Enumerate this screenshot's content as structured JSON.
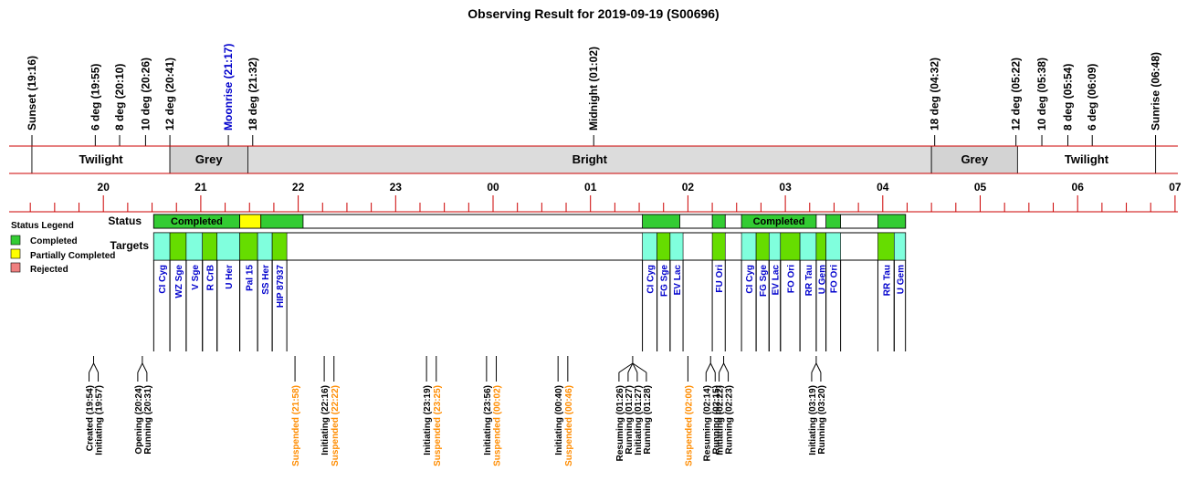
{
  "chart_data": {
    "type": "timeline",
    "title": "Observing Result for 2019-09-19 (S00696)",
    "time_range": [
      -4.8,
      7.0
    ],
    "hour_ticks": [
      "20",
      "21",
      "22",
      "23",
      "00",
      "01",
      "02",
      "03",
      "04",
      "05",
      "06",
      "07"
    ],
    "events": [
      {
        "label": "Sunset (19:16)",
        "t": -4.733,
        "color": "#000000"
      },
      {
        "label": "6 deg (19:55)",
        "t": -4.083,
        "color": "#000000"
      },
      {
        "label": "8 deg (20:10)",
        "t": -3.833,
        "color": "#000000"
      },
      {
        "label": "10 deg (20:26)",
        "t": -3.567,
        "color": "#000000"
      },
      {
        "label": "12 deg (20:41)",
        "t": -3.317,
        "color": "#000000"
      },
      {
        "label": "Moonrise (21:17)",
        "t": -2.717,
        "color": "#0000cc"
      },
      {
        "label": "18 deg (21:32)",
        "t": -2.467,
        "color": "#000000"
      },
      {
        "label": "Midnight (01:02)",
        "t": 1.033,
        "color": "#000000"
      },
      {
        "label": "18 deg (04:32)",
        "t": 4.533,
        "color": "#000000"
      },
      {
        "label": "12 deg (05:22)",
        "t": 5.367,
        "color": "#000000"
      },
      {
        "label": "10 deg (05:38)",
        "t": 5.633,
        "color": "#000000"
      },
      {
        "label": "8 deg (05:54)",
        "t": 5.9,
        "color": "#000000"
      },
      {
        "label": "6 deg (06:09)",
        "t": 6.15,
        "color": "#000000"
      },
      {
        "label": "Sunrise (06:48)",
        "t": 6.8,
        "color": "#000000"
      }
    ],
    "sky_bands": [
      {
        "label": "Twilight",
        "start": -4.733,
        "end": -3.317,
        "color": "#ffffff"
      },
      {
        "label": "Grey",
        "start": -3.317,
        "end": -2.517,
        "color": "#d3d3d3"
      },
      {
        "label": "Bright",
        "start": -2.517,
        "end": 4.5,
        "color": "#dcdcdc"
      },
      {
        "label": "Grey",
        "start": 4.5,
        "end": 5.383,
        "color": "#d3d3d3"
      },
      {
        "label": "Twilight",
        "start": 5.383,
        "end": 6.8,
        "color": "#ffffff"
      }
    ],
    "row_labels": {
      "status": "Status",
      "targets": "Targets"
    },
    "legend": {
      "title": "Status Legend",
      "items": [
        {
          "label": "Completed",
          "color": "#33cc33"
        },
        {
          "label": "Partially Completed",
          "color": "#ffff00"
        },
        {
          "label": "Rejected",
          "color": "#f08080"
        }
      ]
    },
    "status_range": [
      -3.483,
      4.233
    ],
    "status_segments": [
      {
        "start": -3.483,
        "end": -2.6,
        "status": "Completed",
        "color": "#33cc33",
        "label": "Completed"
      },
      {
        "start": -2.6,
        "end": -2.383,
        "status": "Partially Completed",
        "color": "#ffff00",
        "label": ""
      },
      {
        "start": -2.383,
        "end": -1.95,
        "status": "Completed",
        "color": "#33cc33",
        "label": ""
      },
      {
        "start": 1.533,
        "end": 1.917,
        "status": "Completed",
        "color": "#33cc33",
        "label": ""
      },
      {
        "start": 2.25,
        "end": 2.383,
        "status": "Completed",
        "color": "#33cc33",
        "label": ""
      },
      {
        "start": 2.55,
        "end": 3.317,
        "status": "Completed",
        "color": "#33cc33",
        "label": "Completed"
      },
      {
        "start": 3.417,
        "end": 3.567,
        "status": "Completed",
        "color": "#33cc33",
        "label": ""
      },
      {
        "start": 3.95,
        "end": 4.233,
        "status": "Completed",
        "color": "#33cc33",
        "label": ""
      }
    ],
    "target_segments": [
      {
        "start": -3.483,
        "end": -3.317,
        "color": "#80ffdd",
        "name": "CI Cyg"
      },
      {
        "start": -3.317,
        "end": -3.15,
        "color": "#66dd00",
        "name": "WZ Sge"
      },
      {
        "start": -3.15,
        "end": -2.983,
        "color": "#80ffdd",
        "name": "V Sge"
      },
      {
        "start": -2.983,
        "end": -2.833,
        "color": "#66dd00",
        "name": "R CrB"
      },
      {
        "start": -2.833,
        "end": -2.6,
        "color": "#80ffdd",
        "name": "U Her"
      },
      {
        "start": -2.6,
        "end": -2.417,
        "color": "#66dd00",
        "name": "Pal 15"
      },
      {
        "start": -2.417,
        "end": -2.267,
        "color": "#80ffdd",
        "name": "SS Her"
      },
      {
        "start": -2.267,
        "end": -2.117,
        "color": "#66dd00",
        "name": "HIP 87937"
      },
      {
        "start": 1.533,
        "end": 1.683,
        "color": "#80ffdd",
        "name": "CI Cyg"
      },
      {
        "start": 1.683,
        "end": 1.817,
        "color": "#66dd00",
        "name": "FG Sge"
      },
      {
        "start": 1.817,
        "end": 1.95,
        "color": "#80ffdd",
        "name": "EV Lac"
      },
      {
        "start": 2.25,
        "end": 2.383,
        "color": "#66dd00",
        "name": "FU Ori"
      },
      {
        "start": 2.55,
        "end": 2.7,
        "color": "#80ffdd",
        "name": "CI Cyg"
      },
      {
        "start": 2.7,
        "end": 2.833,
        "color": "#66dd00",
        "name": "FG Sge"
      },
      {
        "start": 2.833,
        "end": 2.95,
        "color": "#80ffdd",
        "name": "EV Lac"
      },
      {
        "start": 2.95,
        "end": 3.15,
        "color": "#66dd00",
        "name": "FO Ori"
      },
      {
        "start": 3.15,
        "end": 3.317,
        "color": "#80ffdd",
        "name": "RR Tau"
      },
      {
        "start": 3.317,
        "end": 3.417,
        "color": "#66dd00",
        "name": "U Gem"
      },
      {
        "start": 3.417,
        "end": 3.567,
        "color": "#80ffdd",
        "name": "FO Ori"
      },
      {
        "start": 3.95,
        "end": 4.117,
        "color": "#66dd00",
        "name": "RR Tau"
      },
      {
        "start": 4.117,
        "end": 4.233,
        "color": "#80ffdd",
        "name": "U Gem"
      }
    ],
    "log_groups": [
      {
        "t": -4.1,
        "labels": [
          "Created (19:54)",
          "Initiating (19:57)"
        ],
        "color": "#000000"
      },
      {
        "t": -3.6,
        "labels": [
          "Opening (20:24)",
          "Running (20:31)"
        ],
        "color": "#000000"
      },
      {
        "t": -2.033,
        "labels": [
          "Suspended (21:58)"
        ],
        "color": "#ff8c00"
      },
      {
        "t": -1.733,
        "labels": [
          "Initiating (22:16)"
        ],
        "color": "#000000"
      },
      {
        "t": -1.633,
        "labels": [
          "Suspended (22:22)"
        ],
        "color": "#ff8c00"
      },
      {
        "t": -0.683,
        "labels": [
          "Initiating (23:19)"
        ],
        "color": "#000000"
      },
      {
        "t": -0.583,
        "labels": [
          "Suspended (23:25)"
        ],
        "color": "#ff8c00"
      },
      {
        "t": -0.067,
        "labels": [
          "Initiating (23:56)"
        ],
        "color": "#000000"
      },
      {
        "t": 0.033,
        "labels": [
          "Suspended (00:02)"
        ],
        "color": "#ff8c00"
      },
      {
        "t": 0.667,
        "labels": [
          "Initiating (00:40)"
        ],
        "color": "#000000"
      },
      {
        "t": 0.767,
        "labels": [
          "Suspended (00:46)"
        ],
        "color": "#ff8c00"
      },
      {
        "t": 1.433,
        "labels": [
          "Resuming (01:26)",
          "Running (01:27)",
          "Initiating (01:27)",
          "Running (01:28)"
        ],
        "color": "#000000"
      },
      {
        "t": 2.0,
        "labels": [
          "Suspended (02:00)"
        ],
        "color": "#ff8c00"
      },
      {
        "t": 2.233,
        "labels": [
          "Resuming (02:14)",
          "Running (02:15)"
        ],
        "color": "#000000"
      },
      {
        "t": 2.367,
        "labels": [
          "Initiating (02:22)",
          "Running (02:23)"
        ],
        "color": "#000000"
      },
      {
        "t": 3.317,
        "labels": [
          "Initiating (03:19)",
          "Running (03:20)"
        ],
        "color": "#000000"
      }
    ]
  }
}
